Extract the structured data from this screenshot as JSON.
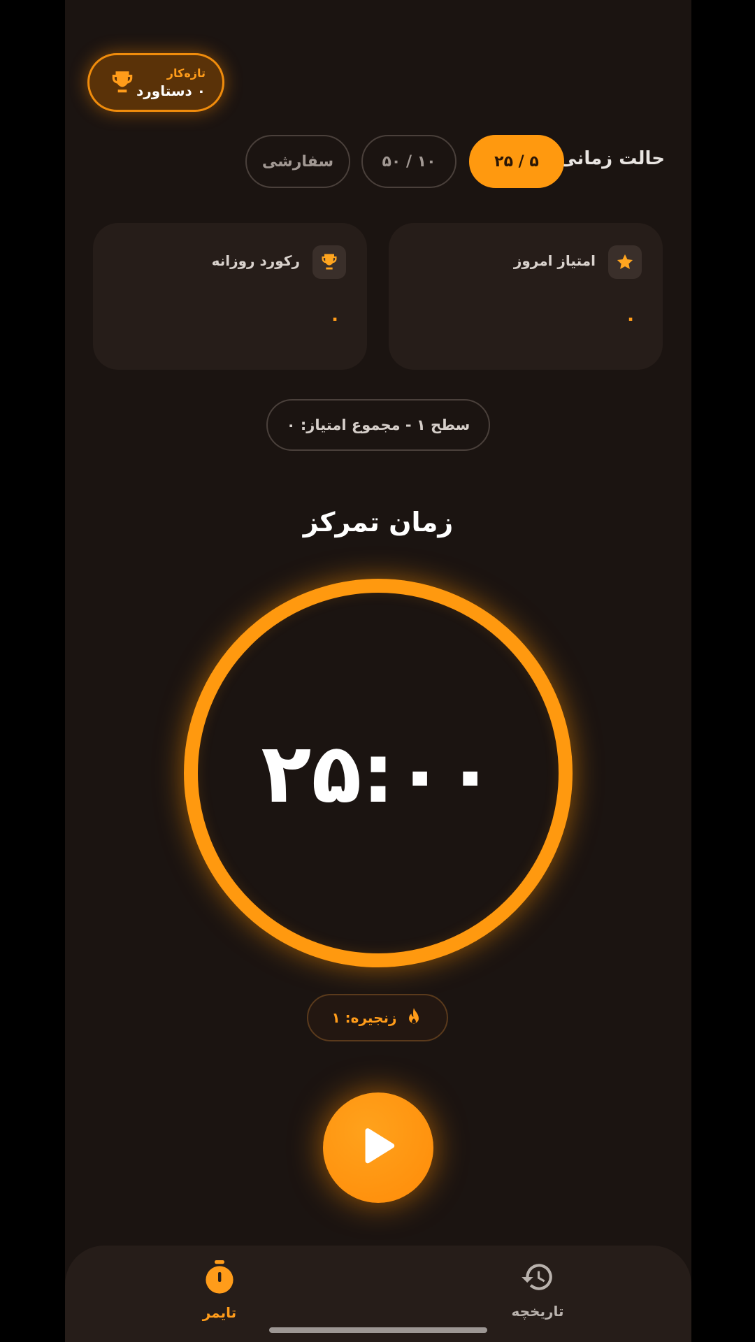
{
  "badge": {
    "subtitle": "تازه‌کار",
    "title": "۰ دستاورد"
  },
  "mode": {
    "label": "حالت زمانی:",
    "options": [
      {
        "label": "۲۵ / ۵",
        "active": true
      },
      {
        "label": "۵۰ / ۱۰",
        "active": false
      },
      {
        "label": "سفارشی",
        "active": false
      }
    ]
  },
  "cards": {
    "today": {
      "title": "امتیاز امروز",
      "value": "۰",
      "icon": "star-icon"
    },
    "record": {
      "title": "رکورد روزانه",
      "value": "۰",
      "icon": "trophy-icon"
    }
  },
  "level": {
    "text": "سطح ۱ - مجموع امتیاز: ۰"
  },
  "timer": {
    "title": "زمان تمرکز",
    "time": "۲۵:۰۰"
  },
  "streak": {
    "label": "زنجیره: ۱",
    "icon": "flame-icon"
  },
  "nav": {
    "timer_label": "تایمر",
    "history_label": "تاریخچه"
  },
  "colors": {
    "accent": "#ff990f",
    "background": "#1b1411",
    "card": "#261d19"
  }
}
